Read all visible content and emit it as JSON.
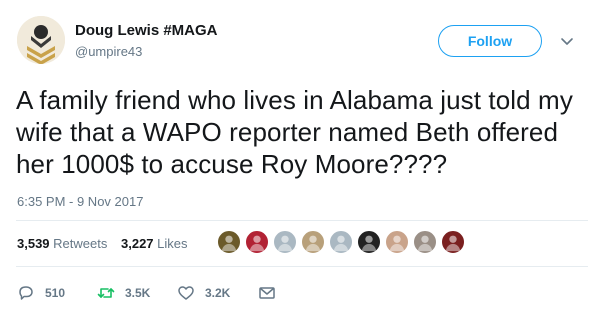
{
  "author": {
    "display_name": "Doug Lewis #MAGA",
    "handle": "@umpire43"
  },
  "follow_button": {
    "label": "Follow"
  },
  "tweet": {
    "text": "A family friend who lives in Alabama  just told my wife that a WAPO reporter named Beth offered her 1000$ to accuse Roy Moore????",
    "timestamp": "6:35 PM - 9 Nov 2017"
  },
  "stats": {
    "retweets_count": "3,539",
    "retweets_label": "Retweets",
    "likes_count": "3,227",
    "likes_label": "Likes"
  },
  "actions": {
    "reply_count": "510",
    "retweet_count": "3.5K",
    "like_count": "3.2K"
  },
  "colors": {
    "accent": "#1da1f2",
    "text_primary": "#14171a",
    "text_secondary": "#657786",
    "retweet_green": "#17bf63",
    "divider": "#e6ecf0"
  },
  "icons": {
    "caret": "chevron-down-icon",
    "reply": "reply-icon",
    "retweet": "retweet-icon",
    "like": "heart-icon",
    "dm": "envelope-icon"
  },
  "liker_avatars": [
    {
      "name": "liker-avatar-1",
      "color": "#6b5a2a"
    },
    {
      "name": "liker-avatar-2",
      "color": "#b22234"
    },
    {
      "name": "liker-avatar-3",
      "color": "#aab8c2"
    },
    {
      "name": "liker-avatar-4",
      "color": "#b8a07a"
    },
    {
      "name": "liker-avatar-5",
      "color": "#aab8c2"
    },
    {
      "name": "liker-avatar-6",
      "color": "#222222"
    },
    {
      "name": "liker-avatar-7",
      "color": "#c9a38a"
    },
    {
      "name": "liker-avatar-8",
      "color": "#9a8f86"
    },
    {
      "name": "liker-avatar-9",
      "color": "#7a1f1f"
    }
  ]
}
